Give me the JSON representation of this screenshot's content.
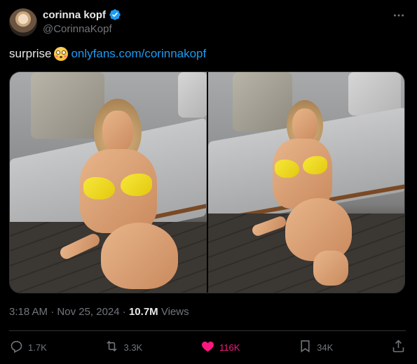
{
  "author": {
    "name": "corinna kopf",
    "handle": "@CorinnaKopf",
    "avatar_icon": "avatar-photo",
    "verified_icon": "verified-badge-icon"
  },
  "more_icon": "more-options-icon",
  "tweet": {
    "text": "surprise",
    "emoji": "flushed-face-emoji",
    "link": "onlyfans.com/corinnakopf"
  },
  "media": {
    "photos": [
      "photo-1",
      "photo-2"
    ]
  },
  "meta": {
    "time": "3:18 AM",
    "sep1": "·",
    "date": "Nov 25, 2024",
    "sep2": "·",
    "views_count": "10.7M",
    "views_label": "Views"
  },
  "actions": {
    "reply": {
      "icon": "reply-icon",
      "count": "1.7K"
    },
    "repost": {
      "icon": "repost-icon",
      "count": "3.3K"
    },
    "like": {
      "icon": "heart-icon",
      "count": "116K",
      "color": "#f91880"
    },
    "bookmark": {
      "icon": "bookmark-icon",
      "count": "34K"
    },
    "share": {
      "icon": "share-icon"
    }
  },
  "colors": {
    "background": "#000000",
    "text": "#e7e9ea",
    "secondary": "#71767b",
    "link": "#1d9bf0",
    "verified": "#1d9bf0",
    "divider": "#2f3336"
  }
}
